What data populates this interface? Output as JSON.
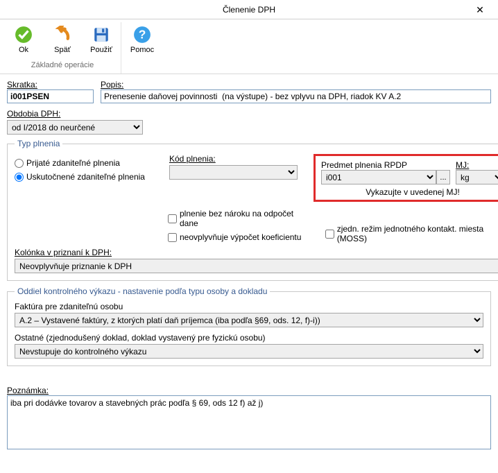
{
  "window": {
    "title": "Členenie DPH",
    "close": "✕"
  },
  "ribbon": {
    "ok": "Ok",
    "spat": "Späť",
    "pouzit": "Použiť",
    "pomoc": "Pomoc",
    "group_label": "Základné operácie"
  },
  "labels": {
    "skratka": "Skratka:",
    "popis": "Popis:",
    "obdobia": "Obdobia DPH:",
    "typ_plnenia": "Typ plnenia",
    "kod_plnenia": "Kód plnenia:",
    "predmet_rpdp": "Predmet plnenia RPDP",
    "mj": "MJ:",
    "vykazujte": "Vykazujte v uvedenej MJ!",
    "plnenie_bez_naroku": "plnenie bez nároku na odpočet dane",
    "neovplyvnuje_koef": "neovplyvňuje výpočet koeficientu",
    "zjedn_rezim": "zjedn. režim jednotného kontakt. miesta (MOSS)",
    "kolonka": "Kolónka v priznaní k DPH:",
    "oddiel": "Oddiel kontrolného výkazu - nastavenie podľa typu osoby a dokladu",
    "faktura": "Faktúra pre zdaniteľnú osobu",
    "ostatne": "Ostatné (zjednodušený doklad, doklad vystavený pre fyzickú osobu)",
    "poznamka": "Poznámka:",
    "dots": "..."
  },
  "values": {
    "skratka": "i001PSEN",
    "popis": "Prenesenie daňovej povinnosti  (na výstupe) - bez vplyvu na DPH, riadok KV A.2",
    "obdobia_selected": "od I/2018 do neurčené",
    "radio_prijate": "Prijaté zdaniteľné plnenia",
    "radio_uskutocnene": "Uskutočnené zdaniteľné plnenia",
    "kod_plnenia": "",
    "predmet_rpdp": "i001",
    "mj": "kg",
    "kolonka_selected": "Neovplyvňuje priznanie k DPH",
    "faktura_selected": "A.2 – Vystavené faktúry, z ktorých platí daň príjemca (iba podľa §69, ods. 12, f)-i))",
    "ostatne_selected": "Nevstupuje do kontrolného výkazu",
    "poznamka": "iba pri dodávke tovarov a stavebných prác podľa § 69, ods 12 f) až j)"
  }
}
